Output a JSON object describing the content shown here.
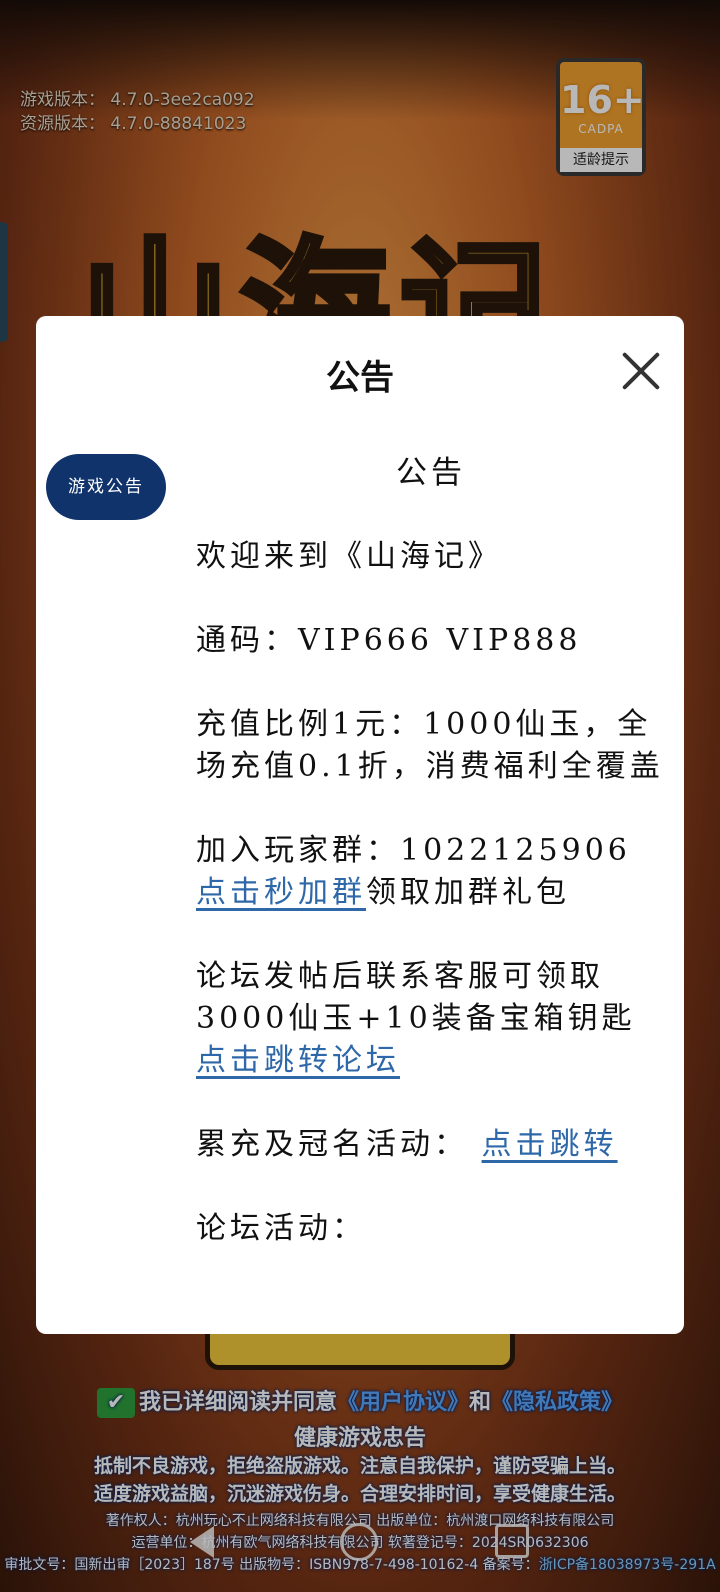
{
  "version": {
    "game_version": "游戏版本： 4.7.0-3ee2ca092",
    "resource_version": "资源版本： 4.7.0-88841023"
  },
  "age_badge": {
    "number": "16+",
    "org": "CADPA",
    "tip": "适龄提示"
  },
  "game_logo": "山海记",
  "modal": {
    "title": "公告",
    "side_tab": "游戏公告",
    "content_heading": "公告",
    "welcome": "欢迎来到《山海记》",
    "code_line": "通码：VIP666 VIP888",
    "recharge": "充值比例1元：1000仙玉，全场充值0.1折，消费福利全覆盖",
    "group_prefix": "加入玩家群：1022125906 ",
    "group_link": "点击秒加群",
    "group_suffix": "领取加群礼包",
    "forum_text": "论坛发帖后联系客服可领取3000仙玉+10装备宝箱钥匙",
    "forum_link": "点击跳转论坛",
    "activity_prefix": "累充及冠名活动： ",
    "activity_link": "点击跳转",
    "forum_activity": "论坛活动："
  },
  "footer": {
    "agree_prefix": "我已详细阅读并同意",
    "user_agreement": "《用户协议》",
    "and": "和",
    "privacy_policy": "《隐私政策》",
    "health_title": "健康游戏忠告",
    "health_line1": "抵制不良游戏，拒绝盗版游戏。注意自我保护，谨防受骗上当。",
    "health_line2": "适度游戏益脑，沉迷游戏伤身。合理安排时间，享受健康生活。",
    "legal_line1": "著作权人：杭州玩心不止网络科技有限公司  出版单位：杭州渡口网络科技有限公司",
    "legal_line2": "运营单位：杭州有欧气网络科技有限公司  软著登记号：2024SR0632306",
    "legal_line3_prefix": "审批文号：国新出审［2023］187号 出版物号：ISBN978-7-498-10162-4 备案号：",
    "legal_line3_icp": "浙ICP备18038973号-291A"
  }
}
